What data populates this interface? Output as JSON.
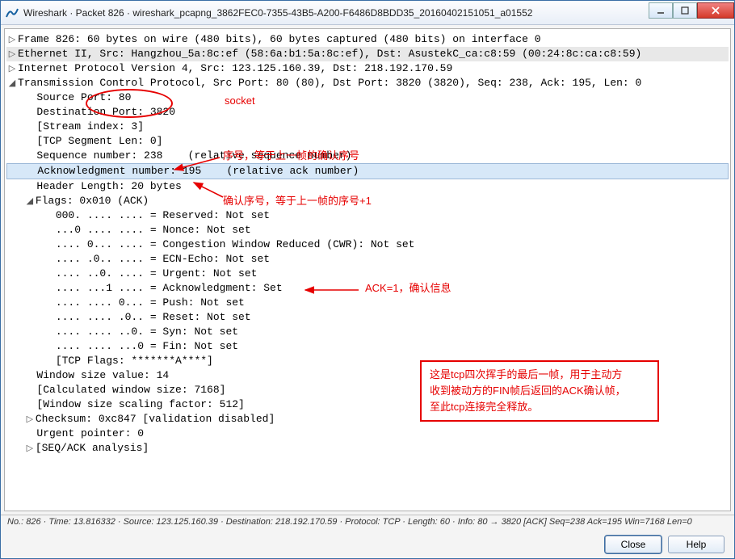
{
  "window": {
    "title": "Wireshark · Packet 826 · wireshark_pcapng_3862FEC0-7355-43B5-A200-F6486D8BDD35_20160402151051_a01552"
  },
  "tree": {
    "frame": "Frame 826: 60 bytes on wire (480 bits), 60 bytes captured (480 bits) on interface 0",
    "eth": "Ethernet II, Src: Hangzhou_5a:8c:ef (58:6a:b1:5a:8c:ef), Dst: AsustekC_ca:c8:59 (00:24:8c:ca:c8:59)",
    "ip": "Internet Protocol Version 4, Src: 123.125.160.39, Dst: 218.192.170.59",
    "tcp": "Transmission Control Protocol, Src Port: 80 (80), Dst Port: 3820 (3820), Seq: 238, Ack: 195, Len: 0",
    "srcport": "Source Port: 80",
    "dstport": "Destination Port: 3820",
    "stream": "[Stream index: 3]",
    "seglen": "[TCP Segment Len: 0]",
    "seq": "Sequence number: 238    (relative sequence number)",
    "ack": "Acknowledgment number: 195    (relative ack number)",
    "hdrlen": "Header Length: 20 bytes",
    "flags": "Flags: 0x010 (ACK)",
    "f_res": "000. .... .... = Reserved: Not set",
    "f_nonce": "...0 .... .... = Nonce: Not set",
    "f_cwr": ".... 0... .... = Congestion Window Reduced (CWR): Not set",
    "f_ecn": ".... .0.. .... = ECN-Echo: Not set",
    "f_urg": ".... ..0. .... = Urgent: Not set",
    "f_ack": ".... ...1 .... = Acknowledgment: Set",
    "f_psh": ".... .... 0... = Push: Not set",
    "f_rst": ".... .... .0.. = Reset: Not set",
    "f_syn": ".... .... ..0. = Syn: Not set",
    "f_fin": ".... .... ...0 = Fin: Not set",
    "f_str": "[TCP Flags: *******A****]",
    "win": "Window size value: 14",
    "calcwin": "[Calculated window size: 7168]",
    "scale": "[Window size scaling factor: 512]",
    "chk": "Checksum: 0xc847 [validation disabled]",
    "urgptr": "Urgent pointer: 0",
    "seqack": "[SEQ/ACK analysis]"
  },
  "ann": {
    "socket": "socket",
    "seq_note": "序号，等于上一帧的确认序号",
    "ack_note": "确认序号，等于上一帧的序号+1",
    "flag_note": "ACK=1，确认信息",
    "box_l1": "这是tcp四次挥手的最后一帧，用于主动方",
    "box_l2": "收到被动方的FIN帧后返回的ACK确认帧，",
    "box_l3": "至此tcp连接完全释放。"
  },
  "status": "No.: 826 · Time: 13.816332 · Source: 123.125.160.39 · Destination: 218.192.170.59 · Protocol: TCP · Length: 60 · Info: 80 → 3820 [ACK] Seq=238 Ack=195 Win=7168 Len=0",
  "buttons": {
    "close": "Close",
    "help": "Help"
  }
}
